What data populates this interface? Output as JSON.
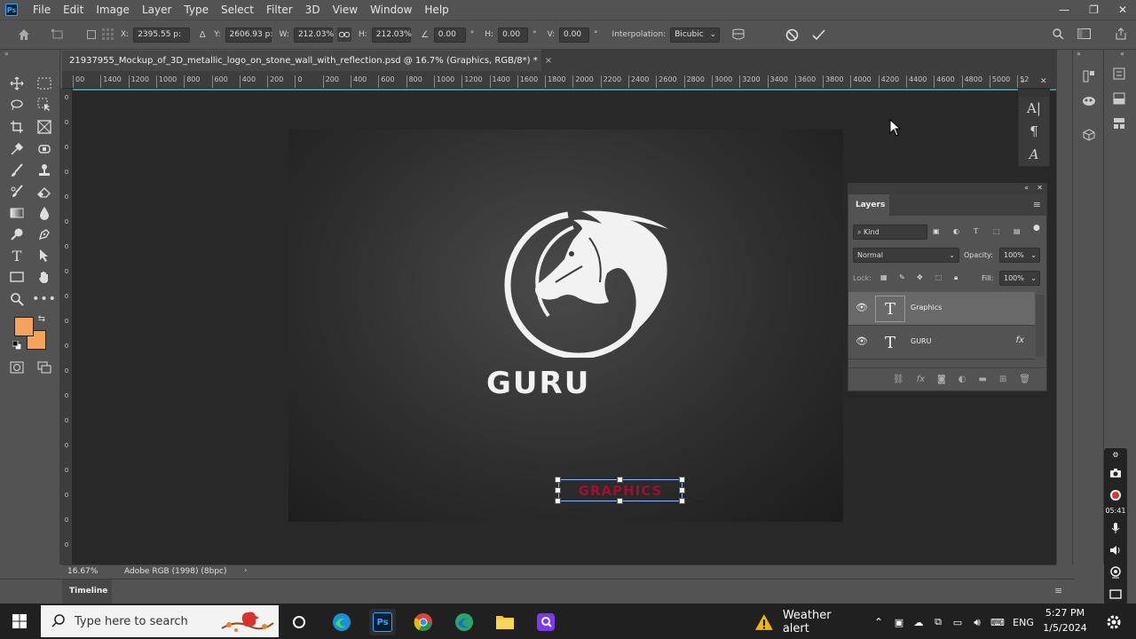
{
  "app": {
    "logo_text": "Ps",
    "menu": [
      "File",
      "Edit",
      "Image",
      "Layer",
      "Type",
      "Select",
      "Filter",
      "3D",
      "View",
      "Window",
      "Help"
    ],
    "window_controls": {
      "minimize": "—",
      "restore": "❐",
      "close": "✕"
    }
  },
  "options_bar": {
    "x_label": "X:",
    "x_value": "2395.55 p:",
    "y_label": "Y:",
    "y_value": "2606.93 p:",
    "w_label": "W:",
    "w_value": "212.03%",
    "h_label": "H:",
    "h_value": "212.03%",
    "angle_value": "0.00",
    "hskew_label": "H:",
    "hskew_value": "0.00",
    "vskew_label": "V:",
    "vskew_value": "0.00",
    "degree_symbol": "°",
    "interpolation_label": "Interpolation:",
    "interpolation_value": "Bicubic"
  },
  "document": {
    "tab_title": "21937955_Mockup_of_3D_metallic_logo_on_stone_wall_with_reflection.psd @ 16.7% (Graphics, RGB/8*) *",
    "tab_close": "×"
  },
  "ruler": {
    "h_ticks": [
      "00",
      "1400",
      "1200",
      "1000",
      "800",
      "600",
      "400",
      "200",
      "0",
      "200",
      "400",
      "600",
      "800",
      "1000",
      "1200",
      "1400",
      "1600",
      "1800",
      "2000",
      "2200",
      "2400",
      "2600",
      "2800",
      "3000",
      "3200",
      "3400",
      "3600",
      "3800",
      "4000",
      "4200",
      "4400",
      "4600",
      "4800",
      "5000",
      "52"
    ],
    "v_ticks": [
      "0",
      "0",
      "0",
      "0",
      "0",
      "0",
      "0",
      "0",
      "0",
      "0",
      "0",
      "0",
      "0",
      "0",
      "0",
      "0",
      "0",
      "0",
      "0"
    ]
  },
  "artwork": {
    "main_text": "GURU",
    "selected_text": "GRAPHICS",
    "accent_color": "#9a1236"
  },
  "layers_panel": {
    "tab": "Layers",
    "kind_placeholder": "Kind",
    "blend_mode": "Normal",
    "opacity_label": "Opacity:",
    "opacity_value": "100%",
    "lock_label": "Lock:",
    "fill_label": "Fill:",
    "fill_value": "100%",
    "layers": [
      {
        "name": "Graphics",
        "type": "text",
        "visible": true,
        "selected": true
      },
      {
        "name": "GURU",
        "type": "text",
        "visible": true,
        "selected": false,
        "fx": "fx"
      }
    ]
  },
  "status": {
    "zoom": "16.67%",
    "color_profile": "Adobe RGB (1998) (8bpc)"
  },
  "timeline": {
    "tab": "Timeline"
  },
  "recorder": {
    "time": "05:41"
  },
  "taskbar": {
    "search_placeholder": "Type here to search",
    "weather": "Weather alert",
    "language": "ENG",
    "time": "5:27 PM",
    "date": "1/5/2024"
  }
}
